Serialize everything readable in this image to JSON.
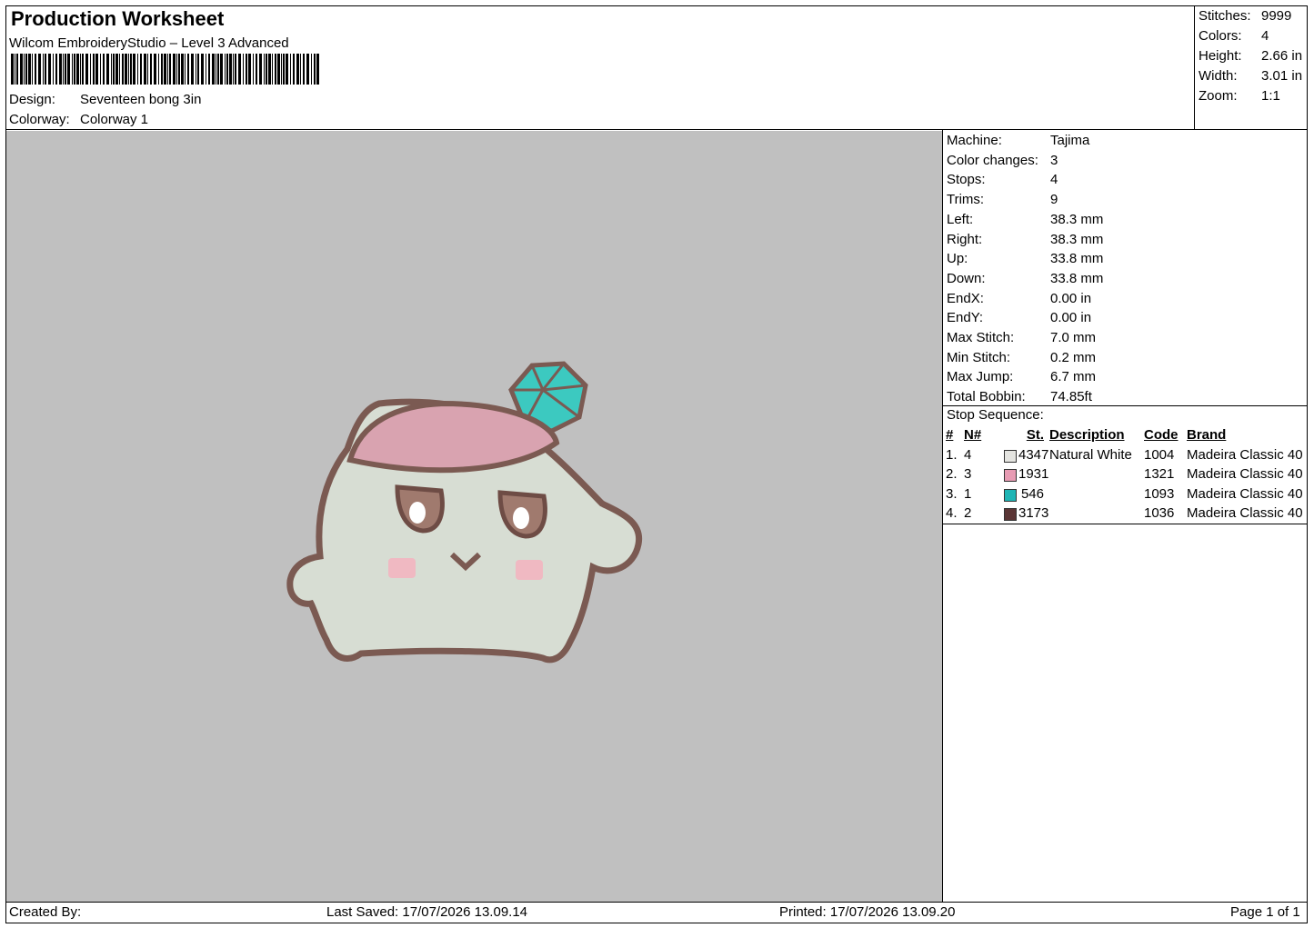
{
  "header": {
    "title": "Production Worksheet",
    "software": "Wilcom EmbroideryStudio – Level 3 Advanced",
    "design_label": "Design:",
    "design_value": "Seventeen bong 3in",
    "colorway_label": "Colorway:",
    "colorway_value": "Colorway 1"
  },
  "summary": [
    {
      "label": "Stitches:",
      "value": "9999"
    },
    {
      "label": "Colors:",
      "value": "4"
    },
    {
      "label": "Height:",
      "value": "2.66 in"
    },
    {
      "label": "Width:",
      "value": "3.01 in"
    },
    {
      "label": "Zoom:",
      "value": "1:1"
    }
  ],
  "machine_info": [
    {
      "label": "Machine:",
      "value": "Tajima"
    },
    {
      "label": "Color changes:",
      "value": "3"
    },
    {
      "label": "Stops:",
      "value": "4"
    },
    {
      "label": "Trims:",
      "value": "9"
    },
    {
      "label": "Left:",
      "value": "38.3 mm"
    },
    {
      "label": "Right:",
      "value": "38.3 mm"
    },
    {
      "label": "Up:",
      "value": "33.8 mm"
    },
    {
      "label": "Down:",
      "value": "33.8 mm"
    },
    {
      "label": "EndX:",
      "value": "0.00 in"
    },
    {
      "label": "EndY:",
      "value": "0.00 in"
    },
    {
      "label": "Max Stitch:",
      "value": "7.0 mm"
    },
    {
      "label": "Min Stitch:",
      "value": "0.2 mm"
    },
    {
      "label": "Max Jump:",
      "value": "6.7 mm"
    },
    {
      "label": "Total Bobbin:",
      "value": "74.85ft"
    }
  ],
  "stop_sequence": {
    "title": "Stop Sequence:",
    "headers": {
      "num": "#",
      "n": "N#",
      "st": "St.",
      "description": "Description",
      "code": "Code",
      "brand": "Brand"
    },
    "rows": [
      {
        "num": "1.",
        "n": "4",
        "color": "#e4e4e0",
        "st": "4347",
        "description": "Natural White",
        "code": "1004",
        "brand": "Madeira Classic 40"
      },
      {
        "num": "2.",
        "n": "3",
        "color": "#e79bb3",
        "st": "1931",
        "description": "",
        "code": "1321",
        "brand": "Madeira Classic 40"
      },
      {
        "num": "3.",
        "n": "1",
        "color": "#1fb5b5",
        "st": "546",
        "description": "",
        "code": "1093",
        "brand": "Madeira Classic 40"
      },
      {
        "num": "4.",
        "n": "2",
        "color": "#5a3535",
        "st": "3173",
        "description": "",
        "code": "1036",
        "brand": "Madeira Classic 40"
      }
    ]
  },
  "footer": {
    "created_by": "Created By:",
    "last_saved": "Last Saved: 17/07/2026 13.09.14",
    "printed": "Printed: 17/07/2026 13.09.20",
    "page": "Page 1 of 1"
  },
  "colors": {
    "canvas": "#c0c0c0",
    "body_fill": "#d7ddd3",
    "outline": "#7b5a52",
    "hat": "#d9a3b0",
    "gem": "#3cc9c0",
    "cheek": "#f0b9c2"
  }
}
